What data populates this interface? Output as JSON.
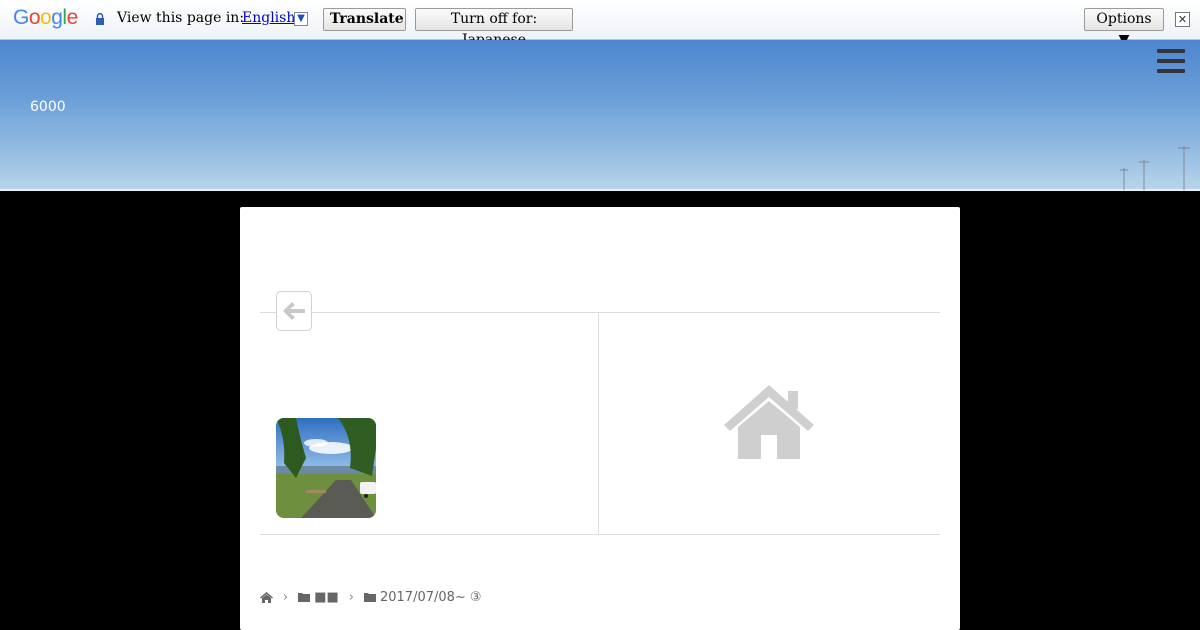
{
  "translate_bar": {
    "logo_text": "Google",
    "prompt": "View this page in:",
    "language": "English",
    "translate_label": "Translate",
    "turn_off_label": "Turn off for: Japanese",
    "options_label": "Options ▼",
    "close_glyph": "✕"
  },
  "header": {
    "site_title": "6000"
  },
  "breadcrumb": {
    "category": "■■",
    "subcategory": "2017/07/08~ ③",
    "separator": "›"
  }
}
